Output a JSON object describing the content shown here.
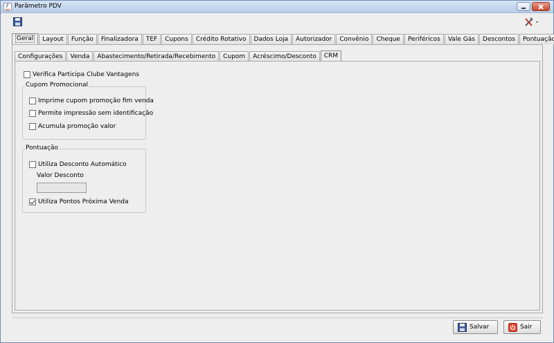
{
  "window": {
    "title": "Parâmetro PDV"
  },
  "main_tabs": [
    {
      "label": "Geral",
      "active": true
    },
    {
      "label": "Layout"
    },
    {
      "label": "Função"
    },
    {
      "label": "Finalizadora"
    },
    {
      "label": "TEF"
    },
    {
      "label": "Cupons"
    },
    {
      "label": "Crédito Rotativo"
    },
    {
      "label": "Dados Loja"
    },
    {
      "label": "Autorizador"
    },
    {
      "label": "Convênio"
    },
    {
      "label": "Cheque"
    },
    {
      "label": "Periféricos"
    },
    {
      "label": "Vale Gás"
    },
    {
      "label": "Descontos"
    },
    {
      "label": "Pontuação"
    }
  ],
  "sub_tabs": [
    {
      "label": "Configurações"
    },
    {
      "label": "Venda"
    },
    {
      "label": "Abastecimento/Retirada/Recebimento"
    },
    {
      "label": "Cupom"
    },
    {
      "label": "Acréscimo/Desconto"
    },
    {
      "label": "CRM",
      "active": true
    }
  ],
  "crm": {
    "verifica_clube": {
      "label": "Verifica Participa Clube Vantagens",
      "checked": false
    },
    "cupom_group": {
      "title": "Cupom Promocional",
      "items": [
        {
          "label": "Imprime cupom promoção fim venda",
          "checked": false
        },
        {
          "label": "Permite impressão sem identificação",
          "checked": false
        },
        {
          "label": "Acumula promoção valor",
          "checked": false
        }
      ]
    },
    "pontuacao_group": {
      "title": "Pontuação",
      "desconto_automatico": {
        "label": "Utiliza Desconto Automático",
        "checked": false
      },
      "valor_desconto_label": "Valor Desconto",
      "valor_desconto_value": "",
      "pontos_proxima_venda": {
        "label": "Utiliza Pontos Próxima Venda",
        "checked": true
      }
    }
  },
  "buttons": {
    "save_label": "Salvar",
    "exit_label": "Sair"
  }
}
